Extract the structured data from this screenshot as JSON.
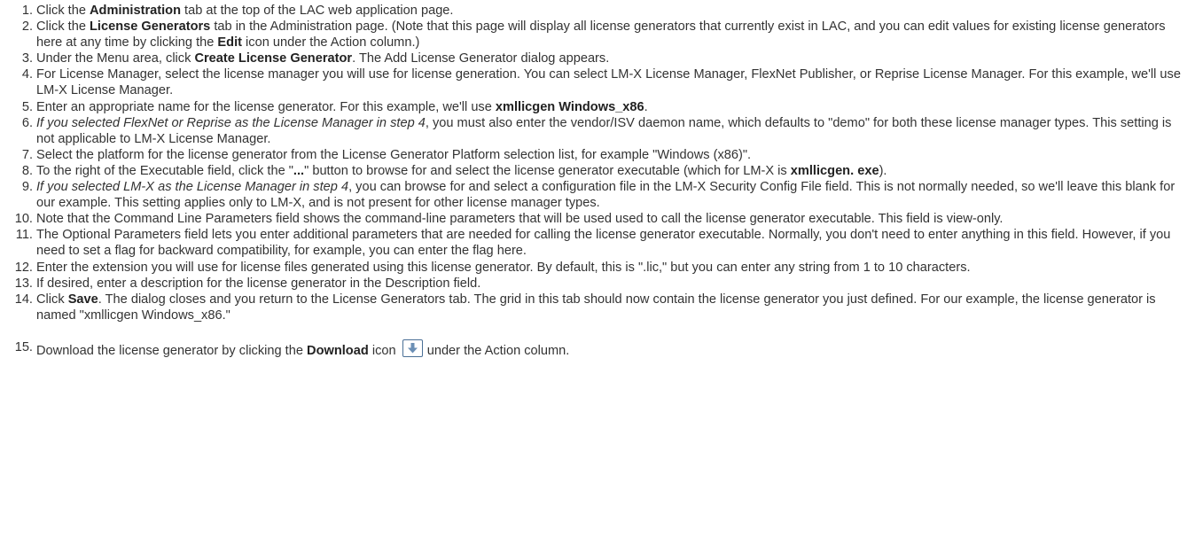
{
  "steps": [
    {
      "n": "1.",
      "parts": [
        "Click the ",
        "Administration",
        " tab at the top of the LAC web application page."
      ]
    },
    {
      "n": "2.",
      "parts": [
        "Click the ",
        "License Generators",
        " tab in the Administration page. (Note that this page will display all license generators that currently exist in LAC, and you can edit values for existing license generators here at any time by clicking the ",
        "Edit",
        " icon under the Action column.)"
      ]
    },
    {
      "n": "3.",
      "parts": [
        "Under the Menu area, click ",
        "Create License Generator",
        ". The Add License Generator dialog appears."
      ]
    },
    {
      "n": "4.",
      "parts": [
        "For License Manager, select the license manager you will use for license generation. You can select LM-X License Manager, FlexNet Publisher, or Reprise License Manager. For this example, we'll use LM-X License Manager."
      ]
    },
    {
      "n": "5.",
      "parts": [
        "Enter an appropriate name for the license generator. For this example, we'll use ",
        "xmllicgen Windows_x86",
        "."
      ]
    },
    {
      "n": "6.",
      "parts": [
        "If you selected FlexNet or Reprise as the License Manager in step 4",
        ", you must also enter the vendor/ISV daemon name, which defaults to \"demo\" for both these license manager types. This setting is not applicable to LM-X License Manager."
      ]
    },
    {
      "n": "7.",
      "parts": [
        "Select the platform for the license generator from the License Generator Platform selection list, for example \"Windows (x86)\"."
      ]
    },
    {
      "n": "8.",
      "parts": [
        "To the right of the Executable field, click the \"",
        "...",
        "\" button to browse for and select the license generator executable (which for LM-X is ",
        "xmllicgen. exe",
        ")."
      ]
    },
    {
      "n": "9.",
      "parts": [
        "If you selected LM-X as the License Manager in step 4",
        ", you can browse for and select a configuration file in the LM-X Security Config File field. This is not normally needed, so we'll leave this blank for our example. This setting applies only to LM-X, and is not present for other license manager types."
      ]
    },
    {
      "n": "10.",
      "parts": [
        "Note that the Command Line Parameters field shows the command-line parameters that will be used used to call the license generator executable. This field is view-only."
      ]
    },
    {
      "n": "11.",
      "parts": [
        "The Optional Parameters field lets you enter additional parameters that are needed for calling the license generator executable. Normally, you don't need to enter anything in this field. However, if you need to set a flag for backward compatibility, for example, you can enter the flag here."
      ]
    },
    {
      "n": "12.",
      "parts": [
        "Enter the extension you will use for license files generated using this license generator. By default, this is \".lic,\" but you can enter any string from 1 to 10 characters."
      ]
    },
    {
      "n": "13.",
      "parts": [
        "If desired, enter a description for the license generator in the Description field."
      ]
    },
    {
      "n": "14.",
      "parts": [
        "Click ",
        "Save",
        ". The dialog closes and you return to the License Generators tab. The grid in this tab should now contain the license generator you just defined. For our example, the license generator is named \"xmllicgen Windows_x86.\""
      ]
    },
    {
      "n": "15.",
      "parts": [
        "Download the license generator by clicking the ",
        "Download",
        " icon",
        " under the Action column."
      ]
    }
  ],
  "icons": {
    "download": "download-arrow-icon"
  },
  "colors": {
    "text": "#333333",
    "icon_border": "#4a6f96",
    "icon_arrow": "#6b8fb5"
  }
}
